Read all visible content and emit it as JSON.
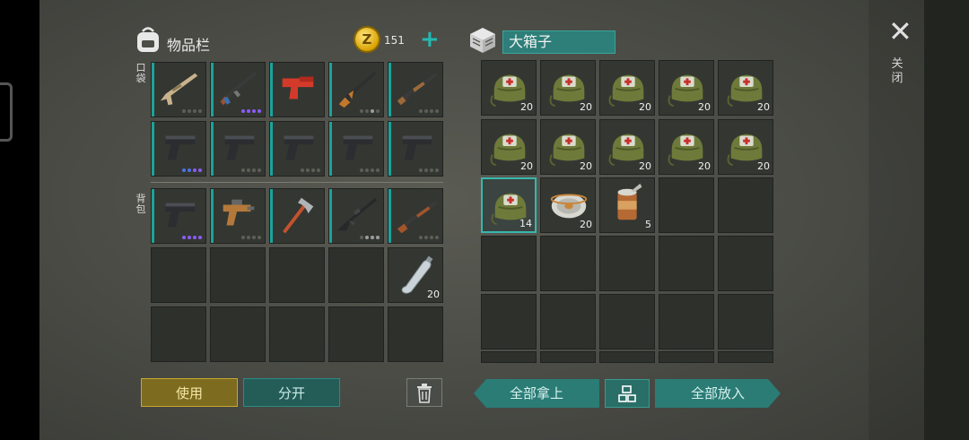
{
  "inventory": {
    "title": "物品栏",
    "coins": "151",
    "pocket_label": "口袋",
    "backpack_label": "背包",
    "pocket_row1": [
      {
        "icon": "assault-rifle-icon",
        "dots": [
          "off",
          "off",
          "off",
          "off"
        ]
      },
      {
        "icon": "ak-rifle-icon",
        "dots": [
          "on",
          "on",
          "on",
          "on"
        ]
      },
      {
        "icon": "flare-gun-icon",
        "dots": []
      },
      {
        "icon": "hunting-rifle-icon",
        "dots": [
          "off",
          "off",
          "lt",
          "off"
        ]
      },
      {
        "icon": "shotgun-icon",
        "dots": [
          "off",
          "off",
          "off",
          "off"
        ]
      }
    ],
    "pocket_row2": [
      {
        "icon": "pistol-icon",
        "dots": [
          "bl",
          "bl",
          "on",
          "on"
        ]
      },
      {
        "icon": "pistol-icon",
        "dots": [
          "off",
          "off",
          "off",
          "off"
        ]
      },
      {
        "icon": "pistol-icon",
        "dots": [
          "off",
          "off",
          "off",
          "off"
        ]
      },
      {
        "icon": "pistol-icon",
        "dots": [
          "off",
          "off",
          "off",
          "off"
        ]
      },
      {
        "icon": "pistol-icon",
        "dots": [
          "off",
          "off",
          "off",
          "off"
        ]
      }
    ],
    "backpack_row1": [
      {
        "icon": "pistol-icon",
        "dots": [
          "on",
          "on",
          "on",
          "on"
        ]
      },
      {
        "icon": "scrap-pistol-icon",
        "dots": [
          "off",
          "off",
          "off",
          "off"
        ]
      },
      {
        "icon": "axe-icon",
        "dots": []
      },
      {
        "icon": "m16-rifle-icon",
        "dots": [
          "off",
          "lt",
          "lt",
          "lt"
        ]
      },
      {
        "icon": "lever-rifle-icon",
        "dots": [
          "off",
          "off",
          "off",
          "off"
        ]
      }
    ],
    "water_bottle_qty": "20"
  },
  "box": {
    "title": "大箱子",
    "medkit_qty": "20",
    "medkit_last_qty": "14",
    "wire_qty": "20",
    "can_qty": "5"
  },
  "close_label": "关闭",
  "buttons": {
    "use": "使用",
    "split": "分开",
    "take_all": "全部拿上",
    "put_all": "全部放入"
  },
  "colors": {
    "accent": "#2a7c75",
    "use_button": "#7d6b1f",
    "rarity_purple": "#8b5cf6"
  }
}
